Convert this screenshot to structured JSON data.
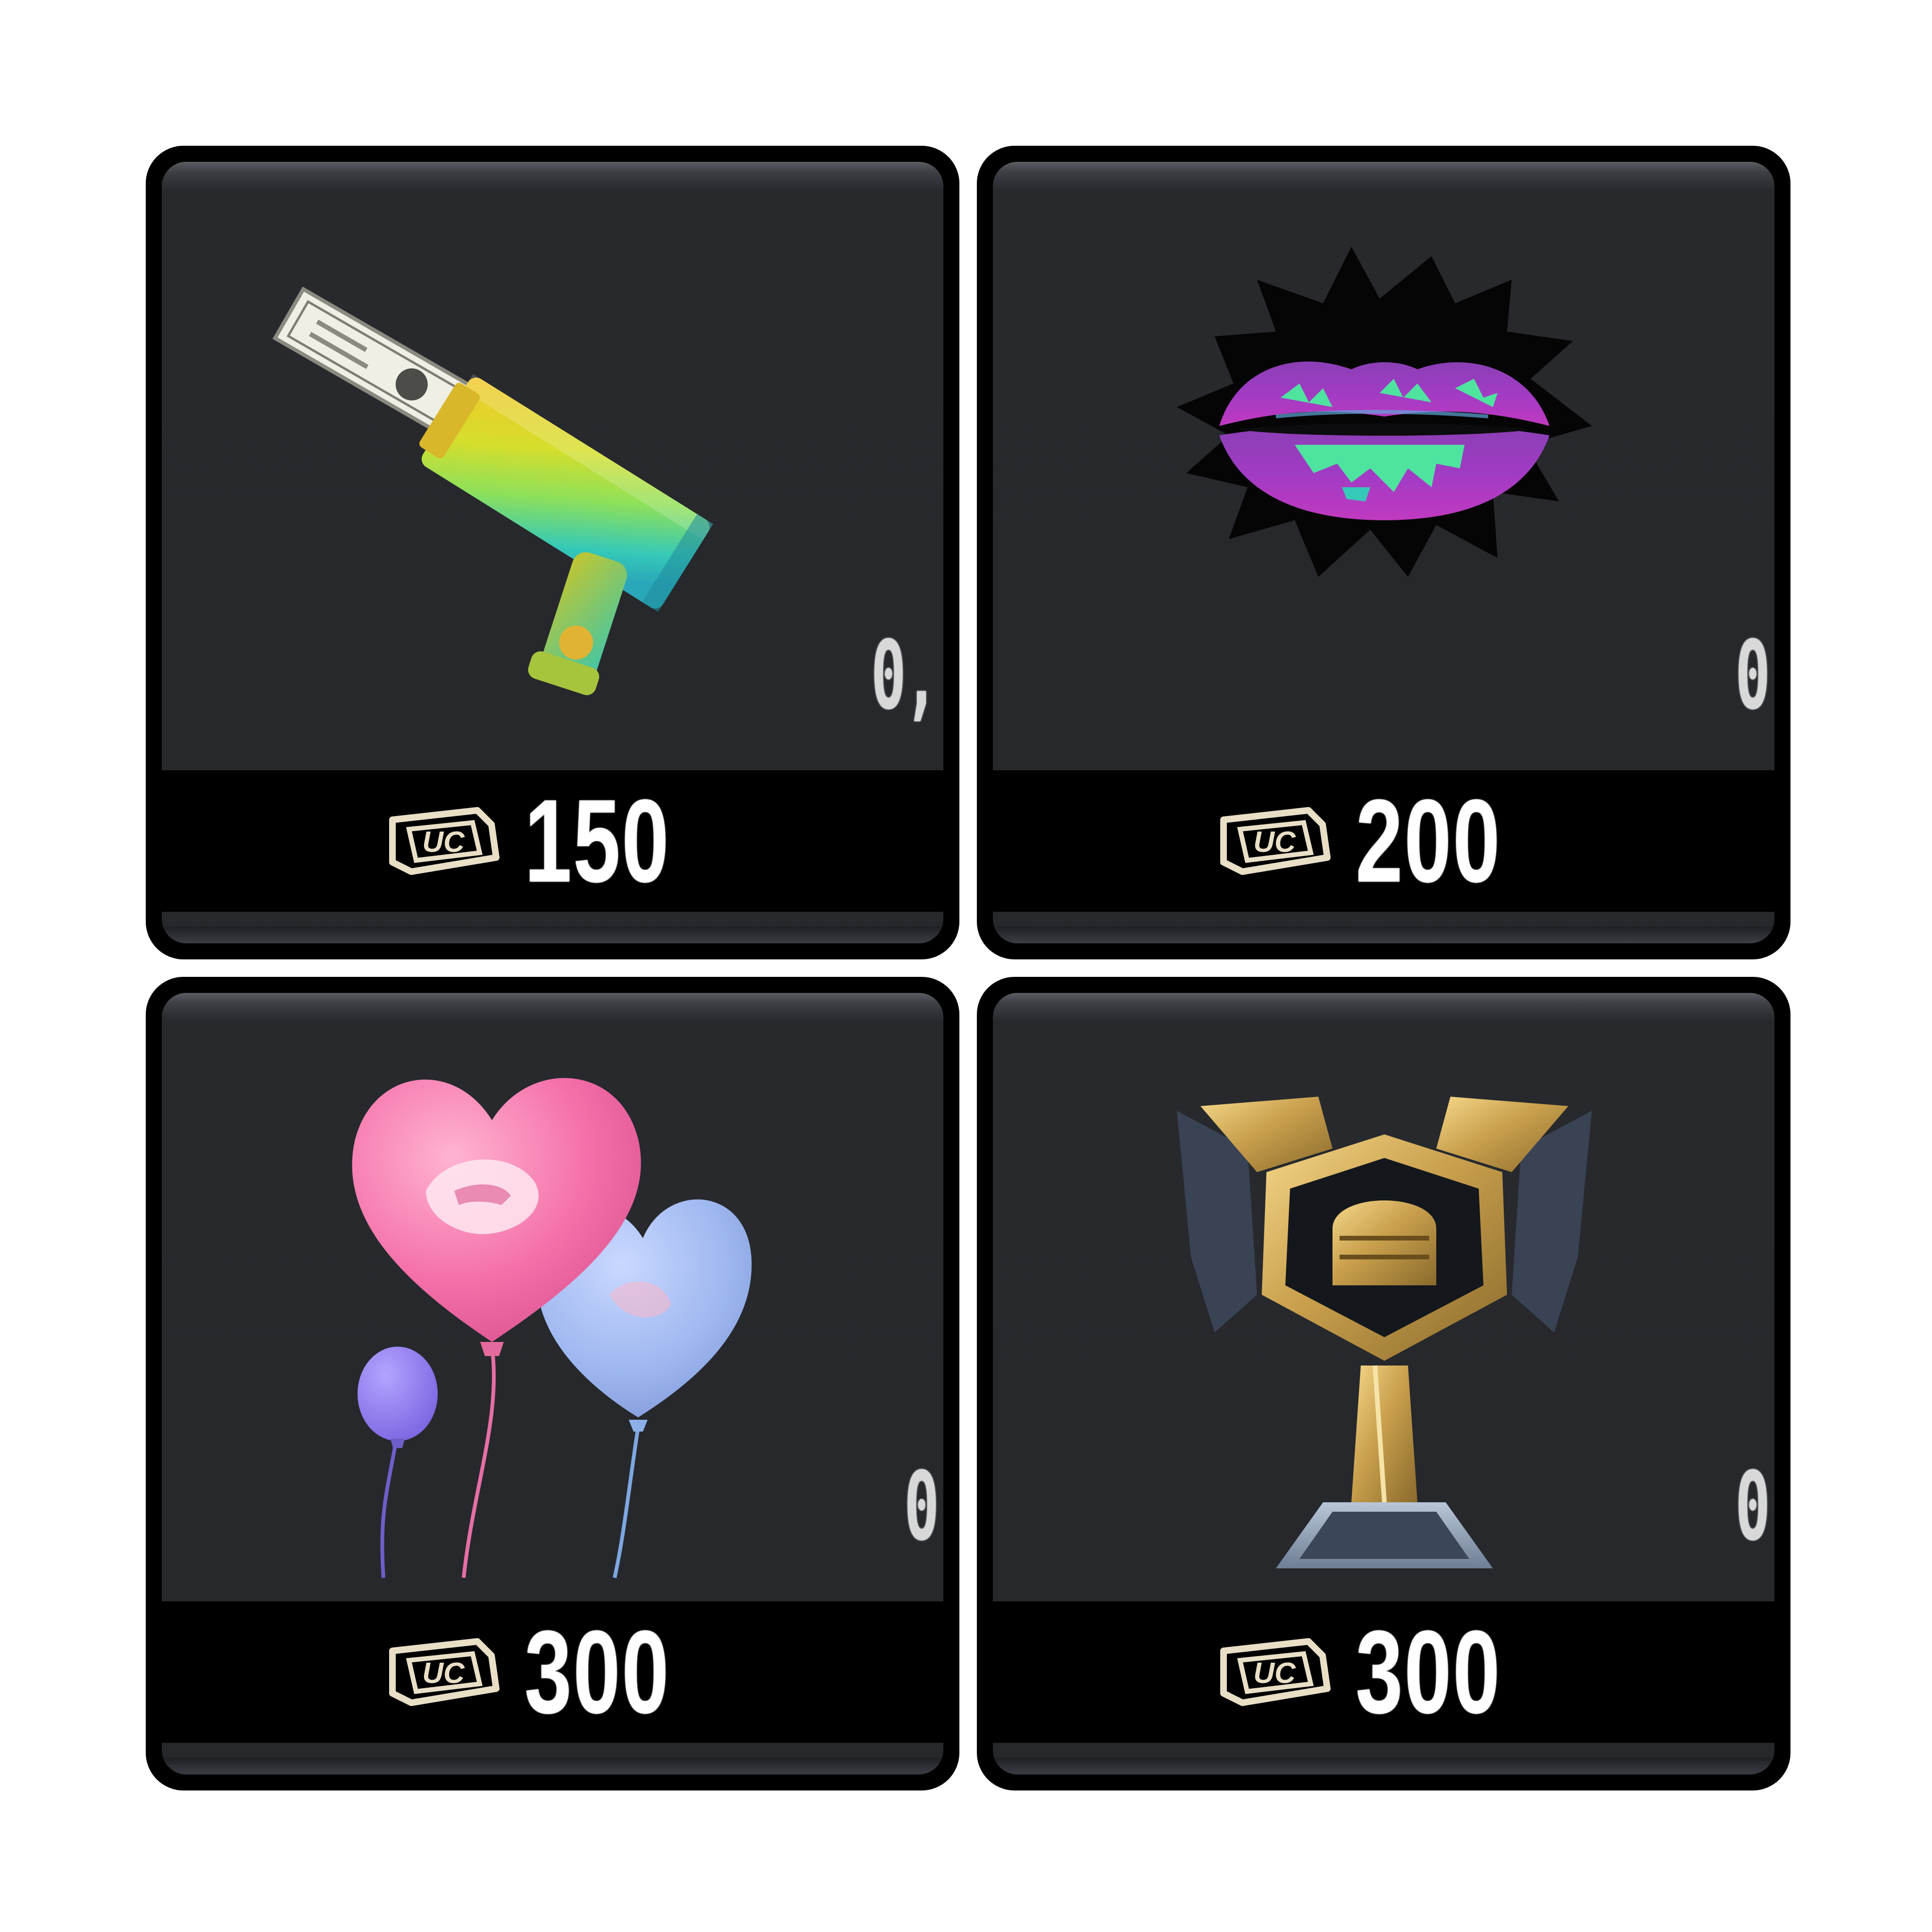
{
  "items": [
    {
      "icon": "money-gun-icon",
      "badge": "0,",
      "currency_icon": "uc-currency-icon",
      "price": "150"
    },
    {
      "icon": "lips-icon",
      "badge": "0",
      "currency_icon": "uc-currency-icon",
      "price": "200"
    },
    {
      "icon": "heart-balloons-icon",
      "badge": "0",
      "currency_icon": "uc-currency-icon",
      "price": "300"
    },
    {
      "icon": "trophy-icon",
      "badge": "0",
      "currency_icon": "uc-currency-icon",
      "price": "300"
    }
  ],
  "colors": {
    "card_background": "#26282c",
    "card_border": "#000000",
    "price_bar": "#000000",
    "price_text": "#ffffff",
    "uc_icon": "#e9dfc6"
  }
}
